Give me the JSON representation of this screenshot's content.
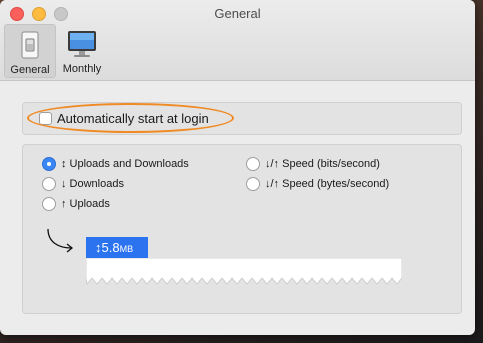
{
  "window": {
    "title": "General"
  },
  "toolbar": {
    "items": [
      {
        "label": "General",
        "icon": "switch-icon",
        "selected": true
      },
      {
        "label": "Monthly",
        "icon": "monitor-icon",
        "selected": false
      }
    ]
  },
  "login": {
    "label": "Automatically start at login",
    "checked": false,
    "highlight_color": "#f08a24"
  },
  "modes": {
    "options": [
      {
        "label": "↕ Uploads and Downloads",
        "selected": true
      },
      {
        "label": "↓ Downloads",
        "selected": false
      },
      {
        "label": "↑ Uploads",
        "selected": false
      }
    ],
    "speeds": [
      {
        "label": "↓/↑ Speed (bits/second)",
        "selected": false
      },
      {
        "label": "↓/↑ Speed (bytes/second)",
        "selected": false
      }
    ]
  },
  "preview": {
    "value": "↕5.8",
    "unit": "MB",
    "accent": "#2c73f0"
  }
}
